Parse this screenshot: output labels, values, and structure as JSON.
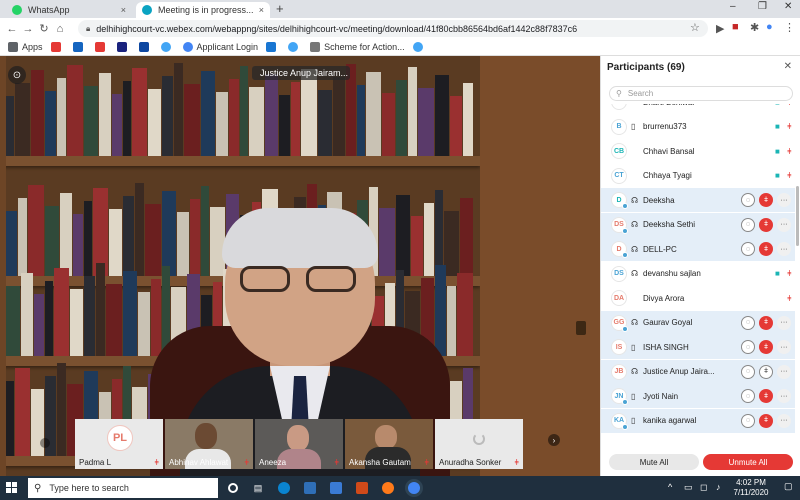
{
  "browser": {
    "tabs": [
      {
        "title": "WhatsApp",
        "close": "×"
      },
      {
        "title": "Meeting is in progress...",
        "close": "×"
      }
    ],
    "new_tab": "+",
    "window_controls": [
      "–",
      "❐",
      "✕"
    ],
    "url": "delhihighcourt-vc.webex.com/webappng/sites/delhihighcourt-vc/meeting/download/41f80cbb86564bd6af1442c88f7837c6",
    "nav": {
      "back": "←",
      "forward": "→",
      "reload": "↻",
      "home": "⌂"
    },
    "bookmarks": [
      {
        "label": "Apps",
        "color": "#5f6368"
      },
      {
        "label": "",
        "color": "#e53935"
      },
      {
        "label": "",
        "color": "#1565c0"
      },
      {
        "label": "",
        "color": "#e53935"
      },
      {
        "label": "",
        "color": "#1a237e"
      },
      {
        "label": "",
        "color": "#0d47a1"
      },
      {
        "label": "",
        "color": "#42a5f5"
      },
      {
        "label": "Applicant Login",
        "color": "#4285f4"
      },
      {
        "label": "",
        "color": "#1976d2"
      },
      {
        "label": "",
        "color": "#42a5f5"
      },
      {
        "label": "Scheme for Action...",
        "color": "#555"
      },
      {
        "label": "",
        "color": "#42a5f5"
      }
    ]
  },
  "stage": {
    "presenter_label": "Justice Anup Jairam...",
    "corner_glyph": "⊙",
    "thumbnails": [
      {
        "name": "Padma L",
        "avatar": "PL",
        "type": "avatar"
      },
      {
        "name": "Abhinav Ahlawat",
        "type": "video"
      },
      {
        "name": "Aneeza",
        "type": "video"
      },
      {
        "name": "Akansha Gautam",
        "type": "video"
      },
      {
        "name": "Anuradha Sonker",
        "type": "loading"
      }
    ],
    "next_glyph": "›"
  },
  "participants": {
    "title": "Participants (69)",
    "close_glyph": "✕",
    "search_placeholder": "Search",
    "mute_all": "Mute All",
    "unmute_all": "Unmute All",
    "list": [
      {
        "initials": "BB",
        "name": "Bharti Beniwal",
        "device": "",
        "highlight": false,
        "cam": true,
        "mic_icon": true,
        "actions": false,
        "color": "#e57a6b",
        "dot": false
      },
      {
        "initials": "B",
        "name": "brurrenu373",
        "device": "▯",
        "highlight": false,
        "cam": true,
        "mic_icon": true,
        "actions": false,
        "color": "#4aa3d4",
        "dot": false
      },
      {
        "initials": "CB",
        "name": "Chhavi Bansal",
        "device": "",
        "highlight": false,
        "cam": true,
        "mic_icon": true,
        "actions": false,
        "color": "#1bb5b5",
        "dot": false
      },
      {
        "initials": "CT",
        "name": "Chhaya Tyagi",
        "device": "",
        "highlight": false,
        "cam": true,
        "mic_icon": true,
        "actions": false,
        "color": "#4aa3d4",
        "dot": false
      },
      {
        "initials": "D",
        "name": "Deeksha",
        "device": "☊",
        "highlight": true,
        "cam": false,
        "mic_icon": false,
        "actions": true,
        "mute_red": true,
        "color": "#1bb5b5",
        "dot": true
      },
      {
        "initials": "DS",
        "name": "Deeksha Sethi",
        "device": "☊",
        "highlight": true,
        "cam": false,
        "mic_icon": false,
        "actions": true,
        "mute_red": true,
        "color": "#e57a6b",
        "dot": true
      },
      {
        "initials": "D",
        "name": "DELL-PC",
        "device": "☊",
        "highlight": true,
        "cam": false,
        "mic_icon": false,
        "actions": true,
        "mute_red": true,
        "color": "#e57a6b",
        "dot": true
      },
      {
        "initials": "DS",
        "name": "devanshu sajlan",
        "device": "☊",
        "highlight": false,
        "cam": true,
        "mic_icon": true,
        "actions": false,
        "color": "#4aa3d4",
        "dot": false
      },
      {
        "initials": "DA",
        "name": "Divya Arora",
        "device": "",
        "highlight": false,
        "cam": false,
        "mic_icon": true,
        "actions": false,
        "color": "#e57a6b",
        "dot": false
      },
      {
        "initials": "GG",
        "name": "Gaurav Goyal",
        "device": "☊",
        "highlight": true,
        "cam": false,
        "mic_icon": false,
        "actions": true,
        "mute_red": true,
        "color": "#e57a6b",
        "dot": true
      },
      {
        "initials": "IS",
        "name": "ISHA SINGH",
        "device": "▯",
        "highlight": true,
        "cam": false,
        "mic_icon": false,
        "actions": true,
        "mute_red": true,
        "color": "#e57a6b",
        "dot": false
      },
      {
        "initials": "JB",
        "name": "Justice Anup Jaira...",
        "device": "☊",
        "highlight": true,
        "cam": false,
        "mic_icon": false,
        "actions": true,
        "mute_red": false,
        "color": "#e57a6b",
        "dot": false
      },
      {
        "initials": "JN",
        "name": "Jyoti Nain",
        "device": "▯",
        "highlight": true,
        "cam": false,
        "mic_icon": false,
        "actions": true,
        "mute_red": true,
        "color": "#4aa3d4",
        "dot": true
      },
      {
        "initials": "KA",
        "name": "kanika agarwal",
        "device": "▯",
        "highlight": true,
        "cam": false,
        "mic_icon": false,
        "actions": true,
        "mute_red": true,
        "color": "#4aa3d4",
        "dot": true
      }
    ],
    "glyphs": {
      "chat": "◌",
      "mic": "ǂ",
      "more": "···",
      "cam": "■",
      "search": "⚲"
    }
  },
  "taskbar": {
    "search_placeholder": "Type here to search",
    "search_glyph": "⚲",
    "tray_glyphs": [
      "^",
      "▭",
      "◻",
      "♪"
    ],
    "time": "4:02 PM",
    "date": "7/11/2020"
  },
  "colors": {
    "accent_red": "#e53935",
    "panel_highlight": "#e4eef8",
    "taskbar": "#1f2f3e"
  }
}
